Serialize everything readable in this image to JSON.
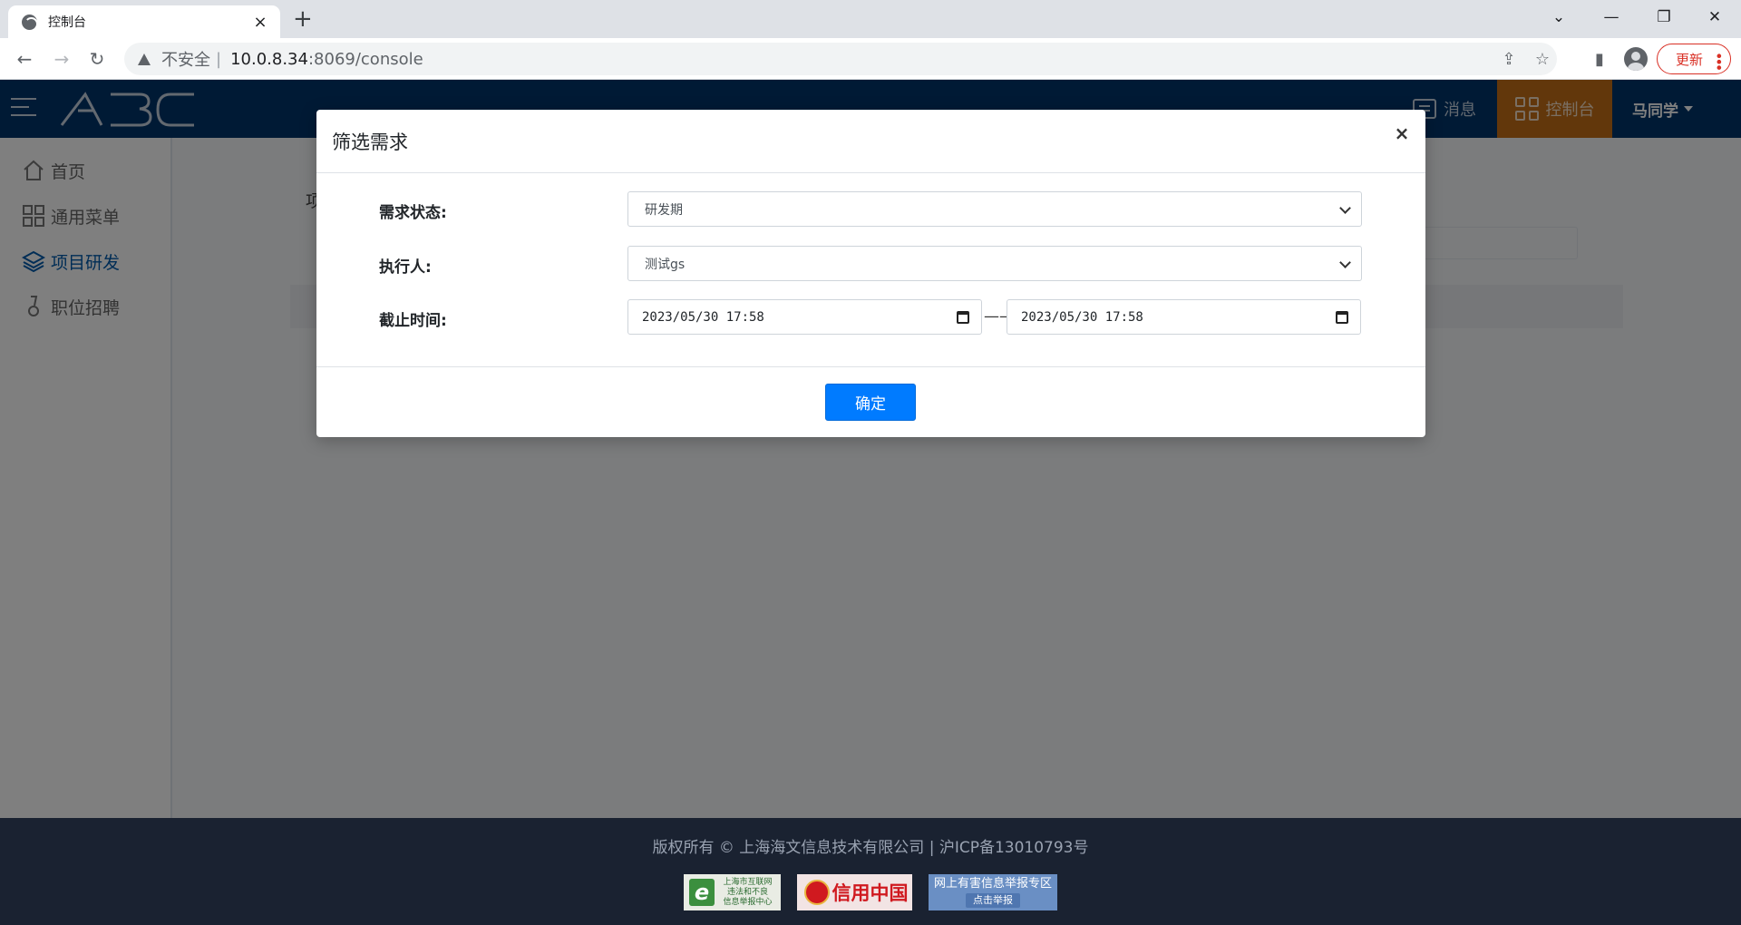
{
  "browser": {
    "tab_title": "控制台",
    "tab_close": "×",
    "new_tab": "+",
    "insecure_label": "不安全",
    "separator": "|",
    "url_host": "10.0.8.34",
    "url_path": ":8069/console",
    "update_label": "更新",
    "window_controls": {
      "dropdown": "⌄",
      "minimize": "—",
      "restore": "❐",
      "close": "✕"
    },
    "nav": {
      "back": "←",
      "forward": "→",
      "reload": "↻"
    },
    "icons": {
      "share": "⇪",
      "star": "☆",
      "sidepanel": "▮"
    }
  },
  "header": {
    "logo_text": "ABC",
    "messages_label": "消息",
    "console_label": "控制台",
    "user_name": "马同学"
  },
  "sidebar": {
    "items": [
      {
        "label": "首页",
        "icon": "home-icon"
      },
      {
        "label": "通用菜单",
        "icon": "grid-icon"
      },
      {
        "label": "项目研发",
        "icon": "layers-icon",
        "active": true
      },
      {
        "label": "职位招聘",
        "icon": "medal-icon"
      }
    ]
  },
  "content": {
    "breadcrumb": "项"
  },
  "modal": {
    "title": "筛选需求",
    "close": "×",
    "fields": {
      "status_label": "需求状态:",
      "status_value": "研发期",
      "assignee_label": "执行人:",
      "assignee_value": "测试gs",
      "deadline_label": "截止时间:",
      "deadline_from": "2023/05/30 17:58",
      "deadline_to": "2023/05/30 17:58",
      "range_separator": "——"
    },
    "confirm_label": "确定"
  },
  "footer": {
    "copyright": "版权所有 © 上海海文信息技术有限公司 | 沪ICP备13010793号",
    "badge1_lines": [
      "上海市互联网",
      "违法和不良",
      "信息举报中心"
    ],
    "badge1_mark": "e",
    "badge2_text": "信用中国",
    "badge3_title": "网上有害信息举报专区",
    "badge3_sub": "点击举报"
  },
  "colors": {
    "header_bg": "#00346b",
    "console_active_bg": "#c56e16",
    "sidebar_active": "#005bac",
    "primary_button": "#007bff",
    "footer_bg": "#1a2231"
  }
}
